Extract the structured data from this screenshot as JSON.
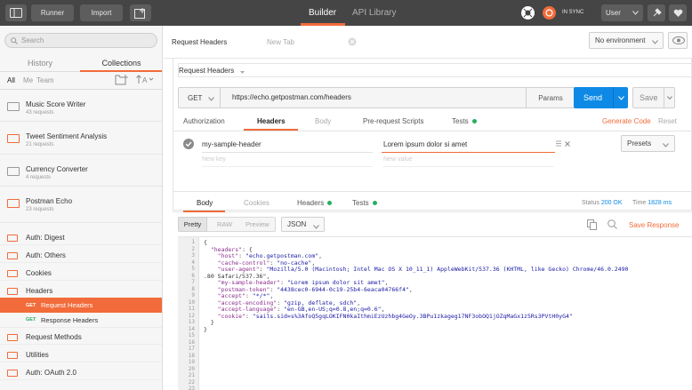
{
  "topbar": {
    "runner": "Runner",
    "import": "Import",
    "builder": "Builder",
    "api_library": "API Library",
    "sync_status": "IN SYNC",
    "user": "User"
  },
  "sidebar": {
    "search_placeholder": "Search",
    "tabs": [
      "History",
      "Collections"
    ],
    "filters": [
      "All",
      "Me",
      "Team"
    ],
    "collections": [
      {
        "name": "Music Score Writer",
        "count": "43 requests"
      },
      {
        "name": "Tweet Sentiment Analysis",
        "count": "21 requests"
      },
      {
        "name": "Currency Converter",
        "count": "4 requests"
      },
      {
        "name": "Postman Echo",
        "count": "23 requests"
      }
    ],
    "folders_a": [
      "Auth: Digest",
      "Auth: Others",
      "Cookies",
      "Headers"
    ],
    "requests": [
      {
        "method": "GET",
        "name": "Request Headers"
      },
      {
        "method": "GET",
        "name": "Response Headers"
      }
    ],
    "folders_b": [
      "Request Methods",
      "Utilities",
      "Auth: OAuth 2.0"
    ]
  },
  "main": {
    "tabs": [
      "Request Headers",
      "New Tab"
    ],
    "environment": "No environment",
    "request_name": "Request Headers",
    "method": "GET",
    "url": "https://echo.getpostman.com/headers",
    "params": "Params",
    "send": "Send",
    "save": "Save",
    "req_tabs": [
      "Authorization",
      "Headers",
      "Body",
      "Pre-request Scripts",
      "Tests"
    ],
    "generate_code": "Generate Code",
    "reset": "Reset",
    "header_key": "my-sample-header",
    "header_value": "Lorem ipsum dolor si amet",
    "new_key_placeholder": "New key",
    "new_value_placeholder": "New value",
    "presets": "Presets",
    "resp_tabs": [
      "Body",
      "Cookies",
      "Headers",
      "Tests"
    ],
    "status_label": "Status",
    "status_value": "200 OK",
    "time_label": "Time",
    "time_value": "1828 ms",
    "view_modes": [
      "Pretty",
      "Raw",
      "Preview"
    ],
    "format": "JSON",
    "save_response": "Save Response"
  },
  "response_lines": [
    "{",
    "  \"headers\": {",
    "    \"host\": \"echo.getpostman.com\",",
    "    \"cache-control\": \"no-cache\",",
    "    \"user-agent\": \"Mozilla/5.0 (Macintosh; Intel Mac OS X 10_11_1) AppleWebKit/537.36 (KHTML, like Gecko) Chrome/46.0.2490",
    ".80 Safari/537.36\",",
    "    \"my-sample-header\": \"Lorem ipsum dolor sit amet\",",
    "    \"postman-token\": \"4438cec0-6944-0c19-25b4-6eaca04766f4\",",
    "    \"accept\": \"*/*\",",
    "    \"accept-encoding\": \"gzip, deflate, sdch\",",
    "    \"accept-language\": \"en-GB,en-US;q=0.8,en;q=0.6\",",
    "    \"cookie\": \"sails.sid=s%3AfoQ5gqLOKIFN0kaIthmiEzUzhbg4GeOy.3BPu1zkageg17NF3obOQ1jOZqMaGx1z5Rs3PVtH0yG4\"",
    "  }",
    "}",
    "",
    "",
    "",
    "",
    "",
    "",
    "",
    "",
    ""
  ]
}
